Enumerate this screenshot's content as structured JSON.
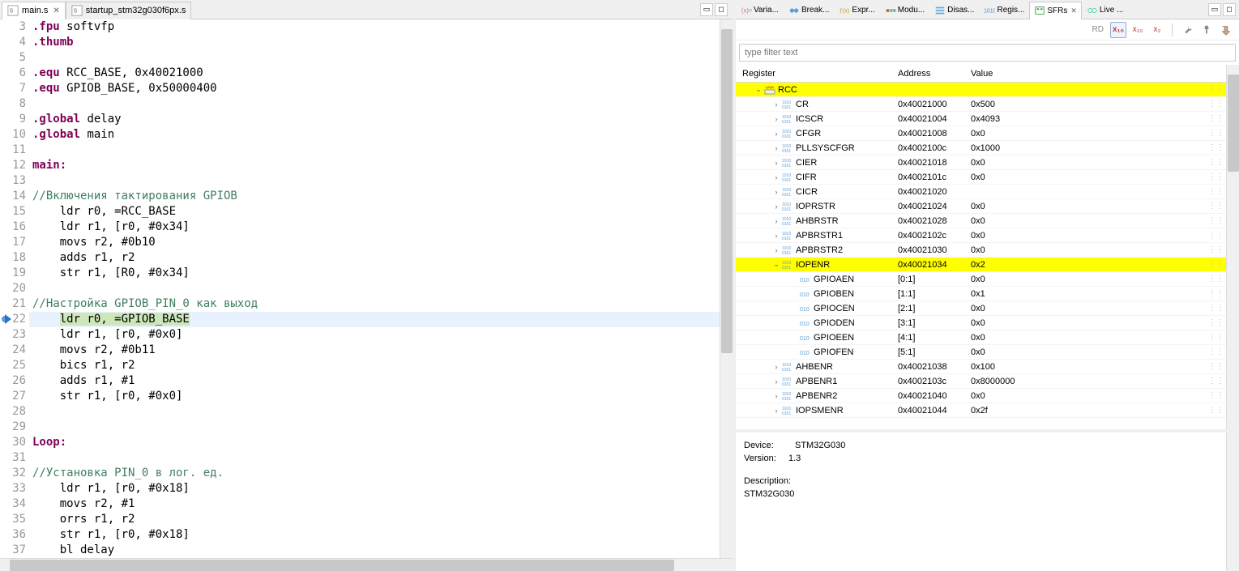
{
  "editor_tabs": [
    {
      "label": "main.s",
      "active": true
    },
    {
      "label": "startup_stm32g030f6px.s",
      "active": false
    }
  ],
  "code": [
    {
      "n": 3,
      "type": "dir",
      "pre": ".fpu",
      "rest": " softvfp"
    },
    {
      "n": 4,
      "type": "dir",
      "pre": ".thumb",
      "rest": ""
    },
    {
      "n": 5,
      "type": "blank"
    },
    {
      "n": 6,
      "type": "dir",
      "pre": ".equ",
      "rest": " RCC_BASE, 0x40021000"
    },
    {
      "n": 7,
      "type": "dir",
      "pre": ".equ",
      "rest": " GPIOB_BASE, 0x50000400"
    },
    {
      "n": 8,
      "type": "blank"
    },
    {
      "n": 9,
      "type": "dir",
      "pre": ".global",
      "rest": " delay"
    },
    {
      "n": 10,
      "type": "dir",
      "pre": ".global",
      "rest": " main"
    },
    {
      "n": 11,
      "type": "blank"
    },
    {
      "n": 12,
      "type": "lbl",
      "text": "main:"
    },
    {
      "n": 13,
      "type": "blank"
    },
    {
      "n": 14,
      "type": "cmt",
      "text": "//Включения тактирования GPIOB"
    },
    {
      "n": 15,
      "type": "txt",
      "text": "    ldr r0, =RCC_BASE"
    },
    {
      "n": 16,
      "type": "txt",
      "text": "    ldr r1, [r0, #0x34]"
    },
    {
      "n": 17,
      "type": "txt",
      "text": "    movs r2, #0b10"
    },
    {
      "n": 18,
      "type": "txt",
      "text": "    adds r1, r2"
    },
    {
      "n": 19,
      "type": "txt",
      "text": "    str r1, [R0, #0x34]"
    },
    {
      "n": 20,
      "type": "blank"
    },
    {
      "n": 21,
      "type": "cmt",
      "text": "//Настройка GPIOB_PIN_0 как выход"
    },
    {
      "n": 22,
      "type": "hl",
      "text": "    ldr r0, =GPIOB_BASE"
    },
    {
      "n": 23,
      "type": "txt",
      "text": "    ldr r1, [r0, #0x0]"
    },
    {
      "n": 24,
      "type": "txt",
      "text": "    movs r2, #0b11"
    },
    {
      "n": 25,
      "type": "txt",
      "text": "    bics r1, r2"
    },
    {
      "n": 26,
      "type": "txt",
      "text": "    adds r1, #1"
    },
    {
      "n": 27,
      "type": "txt",
      "text": "    str r1, [r0, #0x0]"
    },
    {
      "n": 28,
      "type": "blank"
    },
    {
      "n": 29,
      "type": "blank"
    },
    {
      "n": 30,
      "type": "lbl",
      "text": "Loop:"
    },
    {
      "n": 31,
      "type": "blank"
    },
    {
      "n": 32,
      "type": "cmt",
      "text": "//Установка PIN_0 в лог. ед."
    },
    {
      "n": 33,
      "type": "txt",
      "text": "    ldr r1, [r0, #0x18]"
    },
    {
      "n": 34,
      "type": "txt",
      "text": "    movs r2, #1"
    },
    {
      "n": 35,
      "type": "txt",
      "text": "    orrs r1, r2"
    },
    {
      "n": 36,
      "type": "txt",
      "text": "    str r1, [r0, #0x18]"
    },
    {
      "n": 37,
      "type": "txt",
      "text": "    bl delay"
    }
  ],
  "right_tabs": [
    {
      "label": "Varia...",
      "icon": "var"
    },
    {
      "label": "Break...",
      "icon": "brk"
    },
    {
      "label": "Expr...",
      "icon": "expr"
    },
    {
      "label": "Modu...",
      "icon": "mod"
    },
    {
      "label": "Disas...",
      "icon": "dis"
    },
    {
      "label": "Regis...",
      "icon": "reg"
    },
    {
      "label": "SFRs",
      "icon": "sfr",
      "active": true
    },
    {
      "label": "Live ...",
      "icon": "live"
    }
  ],
  "toolbar": {
    "rd": "RD",
    "x16": "x₁₆",
    "x10": "x₁₀",
    "x2": "x₂"
  },
  "filter_placeholder": "type filter text",
  "reg_headers": {
    "name": "Register",
    "addr": "Address",
    "val": "Value"
  },
  "registers": [
    {
      "name": "RCC",
      "addr": "",
      "val": "",
      "lvl": 1,
      "expand": "open",
      "kind": "group",
      "hl": true
    },
    {
      "name": "CR",
      "addr": "0x40021000",
      "val": "0x500",
      "lvl": 2,
      "expand": "closed",
      "kind": "reg"
    },
    {
      "name": "ICSCR",
      "addr": "0x40021004",
      "val": "0x4093",
      "lvl": 2,
      "expand": "closed",
      "kind": "reg"
    },
    {
      "name": "CFGR",
      "addr": "0x40021008",
      "val": "0x0",
      "lvl": 2,
      "expand": "closed",
      "kind": "reg"
    },
    {
      "name": "PLLSYSCFGR",
      "addr": "0x4002100c",
      "val": "0x1000",
      "lvl": 2,
      "expand": "closed",
      "kind": "reg"
    },
    {
      "name": "CIER",
      "addr": "0x40021018",
      "val": "0x0",
      "lvl": 2,
      "expand": "closed",
      "kind": "reg"
    },
    {
      "name": "CIFR",
      "addr": "0x4002101c",
      "val": "0x0",
      "lvl": 2,
      "expand": "closed",
      "kind": "reg"
    },
    {
      "name": "CICR",
      "addr": "0x40021020",
      "val": "",
      "lvl": 2,
      "expand": "closed",
      "kind": "reg"
    },
    {
      "name": "IOPRSTR",
      "addr": "0x40021024",
      "val": "0x0",
      "lvl": 2,
      "expand": "closed",
      "kind": "reg"
    },
    {
      "name": "AHBRSTR",
      "addr": "0x40021028",
      "val": "0x0",
      "lvl": 2,
      "expand": "closed",
      "kind": "reg"
    },
    {
      "name": "APBRSTR1",
      "addr": "0x4002102c",
      "val": "0x0",
      "lvl": 2,
      "expand": "closed",
      "kind": "reg"
    },
    {
      "name": "APBRSTR2",
      "addr": "0x40021030",
      "val": "0x0",
      "lvl": 2,
      "expand": "closed",
      "kind": "reg"
    },
    {
      "name": "IOPENR",
      "addr": "0x40021034",
      "val": "0x2",
      "lvl": 2,
      "expand": "open",
      "kind": "reg",
      "hl": true
    },
    {
      "name": "GPIOAEN",
      "addr": "[0:1]",
      "val": "0x0",
      "lvl": 3,
      "expand": "none",
      "kind": "bit"
    },
    {
      "name": "GPIOBEN",
      "addr": "[1:1]",
      "val": "0x1",
      "lvl": 3,
      "expand": "none",
      "kind": "bit"
    },
    {
      "name": "GPIOCEN",
      "addr": "[2:1]",
      "val": "0x0",
      "lvl": 3,
      "expand": "none",
      "kind": "bit"
    },
    {
      "name": "GPIODEN",
      "addr": "[3:1]",
      "val": "0x0",
      "lvl": 3,
      "expand": "none",
      "kind": "bit"
    },
    {
      "name": "GPIOEEN",
      "addr": "[4:1]",
      "val": "0x0",
      "lvl": 3,
      "expand": "none",
      "kind": "bit"
    },
    {
      "name": "GPIOFEN",
      "addr": "[5:1]",
      "val": "0x0",
      "lvl": 3,
      "expand": "none",
      "kind": "bit"
    },
    {
      "name": "AHBENR",
      "addr": "0x40021038",
      "val": "0x100",
      "lvl": 2,
      "expand": "closed",
      "kind": "reg"
    },
    {
      "name": "APBENR1",
      "addr": "0x4002103c",
      "val": "0x8000000",
      "lvl": 2,
      "expand": "closed",
      "kind": "reg"
    },
    {
      "name": "APBENR2",
      "addr": "0x40021040",
      "val": "0x0",
      "lvl": 2,
      "expand": "closed",
      "kind": "reg"
    },
    {
      "name": "IOPSMENR",
      "addr": "0x40021044",
      "val": "0x2f",
      "lvl": 2,
      "expand": "closed",
      "kind": "reg"
    }
  ],
  "desc": {
    "device_lbl": "Device:",
    "device_val": "STM32G030",
    "version_lbl": "Version:",
    "version_val": "1.3",
    "description_lbl": "Description:",
    "description_val": "STM32G030"
  }
}
